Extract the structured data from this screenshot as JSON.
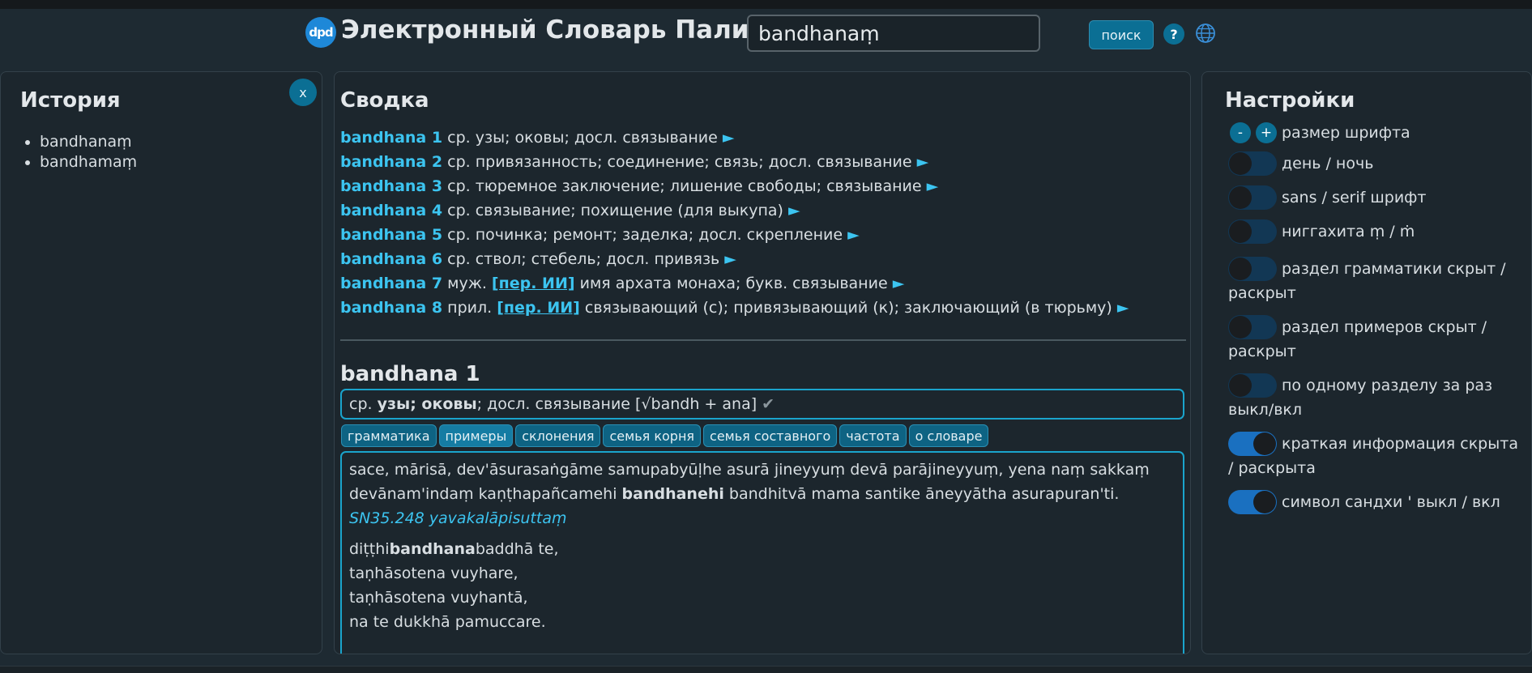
{
  "header": {
    "logo_text": "dpd",
    "title": "Электронный Словарь Пали",
    "search_value": "bandhanaṃ",
    "search_button": "поиск",
    "help_label": "?",
    "globe_icon": "globe-icon"
  },
  "history": {
    "title": "История",
    "close_label": "x",
    "items": [
      "bandhanaṃ",
      "bandhamaṃ"
    ]
  },
  "summary": {
    "title": "Сводка",
    "arrow": "►",
    "rows": [
      {
        "hw": "bandhana 1",
        "pos": "ср.",
        "abbr": "",
        "meaning": "узы; оковы; досл. связывание"
      },
      {
        "hw": "bandhana 2",
        "pos": "ср.",
        "abbr": "",
        "meaning": "привязанность; соединение; связь; досл. связывание"
      },
      {
        "hw": "bandhana 3",
        "pos": "ср.",
        "abbr": "",
        "meaning": "тюремное заключение; лишение свободы; связывание"
      },
      {
        "hw": "bandhana 4",
        "pos": "ср.",
        "abbr": "",
        "meaning": "связывание; похищение (для выкупа)"
      },
      {
        "hw": "bandhana 5",
        "pos": "ср.",
        "abbr": "",
        "meaning": "починка; ремонт; заделка; досл. скрепление"
      },
      {
        "hw": "bandhana 6",
        "pos": "ср.",
        "abbr": "",
        "meaning": "ствол; стебель; досл. привязь"
      },
      {
        "hw": "bandhana 7",
        "pos": "муж.",
        "abbr": "[пер. ИИ]",
        "meaning": "имя архата монаха; букв. связывание"
      },
      {
        "hw": "bandhana 8",
        "pos": "прил.",
        "abbr": "[пер. ИИ]",
        "meaning": "связывающий (с); привязывающий (к); заключающий (в тюрьму)"
      }
    ]
  },
  "entry": {
    "title": "bandhana 1",
    "pos": "ср.",
    "meaning_bold": "узы; оковы",
    "meaning_rest": "; досл. связывание [√bandh + ana]",
    "check": "✔",
    "tabs": [
      "грамматика",
      "примеры",
      "склонения",
      "семья корня",
      "семья составного",
      "частота",
      "о словаре"
    ],
    "example1": {
      "before": "sace, mārisā, dev'āsurasaṅgāme samupabyūḷhe asurā jineyyuṃ devā parājineyyuṃ, yena naṃ sakkaṃ devānam'indaṃ kaṇṭhapañcamehi ",
      "bold": "bandhanehi",
      "after": " bandhitvā mama santike āneyyātha asurapuran'ti.",
      "source": "SN35.248 yavakalāpisuttaṃ"
    },
    "example2": {
      "line1_pre": "diṭṭhi",
      "line1_bold": "bandhana",
      "line1_post": "baddhā te,",
      "line2": "taṇhāsotena vuyhare,",
      "line3": "taṇhāsotena vuyhantā,",
      "line4": "na te dukkhā pamuccare."
    }
  },
  "settings": {
    "title": "Настройки",
    "minus": "-",
    "plus": "+",
    "font_size_label": "размер шрифта",
    "toggles": [
      {
        "label": "день / ночь",
        "on": false
      },
      {
        "label": "sans / serif шрифт",
        "on": false
      },
      {
        "label": "ниггахита ṃ / ṁ",
        "on": false
      },
      {
        "label": "раздел грамматики скрыт / раскрыт",
        "on": false
      },
      {
        "label": "раздел примеров скрыт / раскрыт",
        "on": false
      },
      {
        "label": "по одному разделу за раз выкл/вкл",
        "on": false
      },
      {
        "label": "краткая информация скрыта / раскрыта",
        "on": true
      },
      {
        "label": "символ сандхи ' выкл / вкл",
        "on": true
      }
    ]
  },
  "colors": {
    "accent": "#3cc4f0",
    "button": "#0b6f94",
    "background": "#1e2a32"
  }
}
